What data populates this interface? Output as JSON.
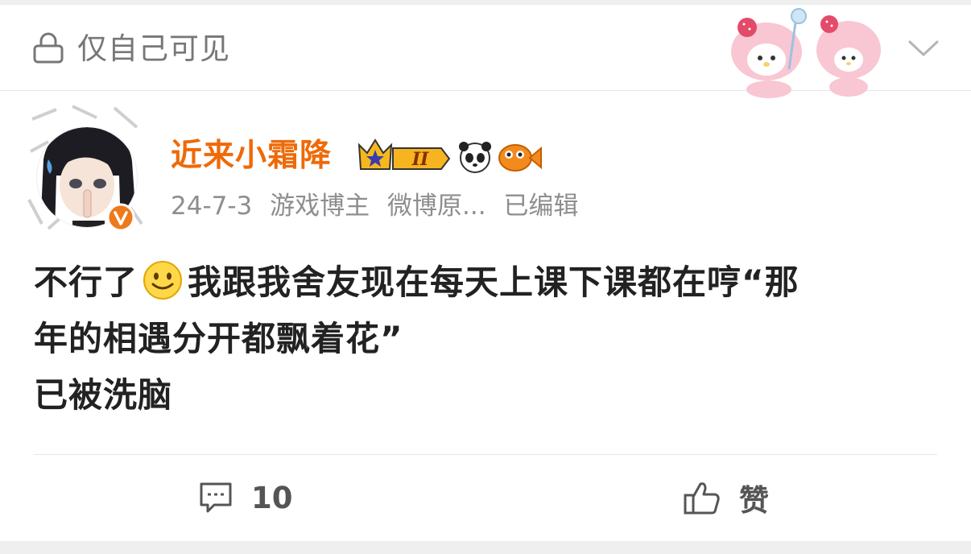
{
  "header": {
    "visibility_label": "仅自己可见",
    "icons": {
      "lock": "lock-icon",
      "expand": "chevron-down-icon",
      "decoration": "my-melody-stickers"
    }
  },
  "author": {
    "name": "近来小霜降",
    "name_color": "#ee6a08",
    "badges": [
      "crown-level-badge",
      "panda-icon",
      "goldfish-icon"
    ],
    "level_text": "II",
    "verified": true
  },
  "meta": {
    "date": "24-7-3",
    "tags": [
      "游戏博主",
      "微博原..."
    ],
    "edited": "已编辑"
  },
  "post": {
    "line1_before": "不行了",
    "emoji": "smile-emoji",
    "line1_after": "我跟我舍友现在每天上课下课都在哼“那",
    "line2": "年的相遇分开都飘着花”",
    "line3": "已被洗脑"
  },
  "actions": {
    "comment_count": "10",
    "like_label": "赞"
  }
}
